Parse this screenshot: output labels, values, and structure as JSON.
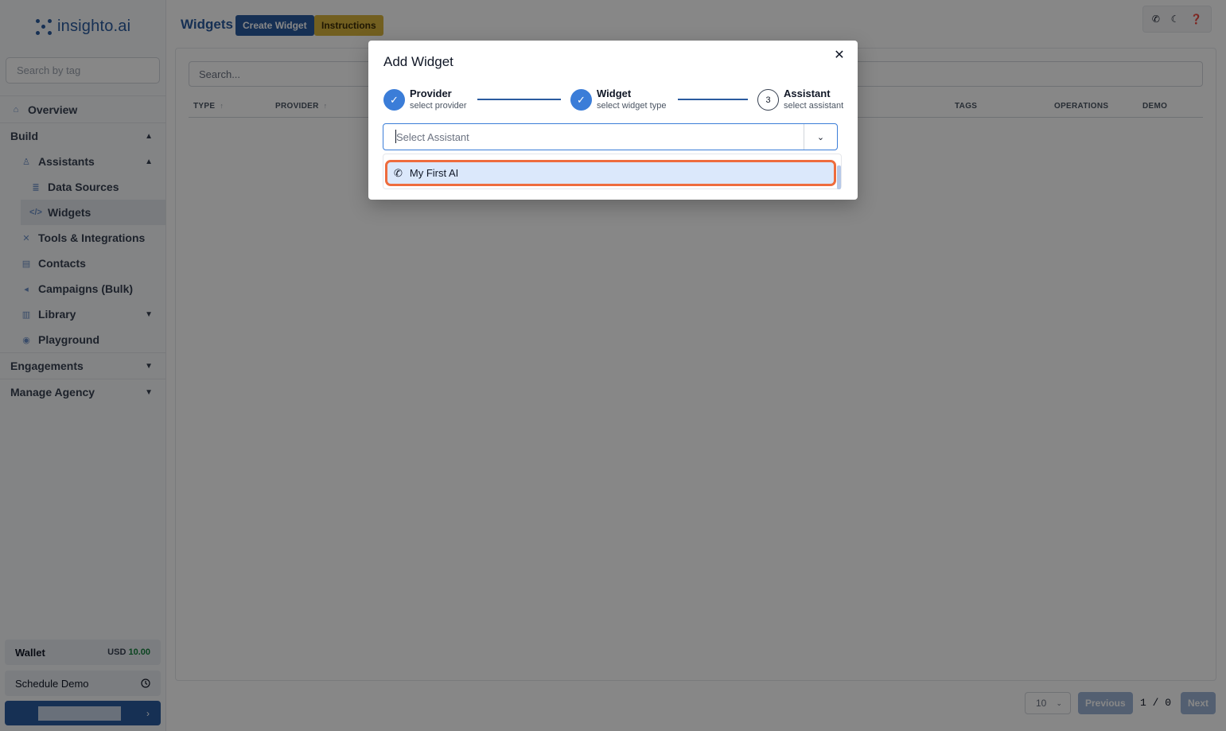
{
  "app": {
    "logo_text": "insighto.ai",
    "tag_search_placeholder": "Search by tag"
  },
  "sidebar": {
    "overview": "Overview",
    "build": "Build",
    "assistants": "Assistants",
    "data_sources": "Data Sources",
    "widgets": "Widgets",
    "tools": "Tools & Integrations",
    "contacts": "Contacts",
    "campaigns": "Campaigns (Bulk)",
    "library": "Library",
    "playground": "Playground",
    "engagements": "Engagements",
    "manage_agency": "Manage Agency",
    "wallet_label": "Wallet",
    "wallet_currency": "USD",
    "wallet_amount": "10.00",
    "schedule_demo": "Schedule Demo"
  },
  "header": {
    "title": "Widgets",
    "create_button": "Create Widget",
    "instructions_button": "Instructions"
  },
  "table": {
    "search_placeholder": "Search...",
    "columns": [
      "TYPE",
      "PROVIDER",
      "TAGS",
      "OPERATIONS",
      "DEMO"
    ]
  },
  "pagination": {
    "page_size": "10",
    "previous": "Previous",
    "page_count": "1 / 0",
    "next": "Next"
  },
  "modal": {
    "title": "Add Widget",
    "steps": [
      {
        "title": "Provider",
        "subtitle": "select provider",
        "status": "done"
      },
      {
        "title": "Widget",
        "subtitle": "select widget type",
        "status": "done"
      },
      {
        "title": "Assistant",
        "subtitle": "select assistant",
        "status": "current",
        "number": "3"
      }
    ],
    "select_placeholder": "Select Assistant",
    "options": [
      {
        "label": "My First AI",
        "icon": "phone-icon",
        "highlighted": true
      }
    ]
  },
  "colors": {
    "brand": "#2a5b9f",
    "accent": "#3b7dd8",
    "instructions": "#d7b33d",
    "highlight_border": "#ee6c3d",
    "wallet_amount": "#15803d"
  }
}
